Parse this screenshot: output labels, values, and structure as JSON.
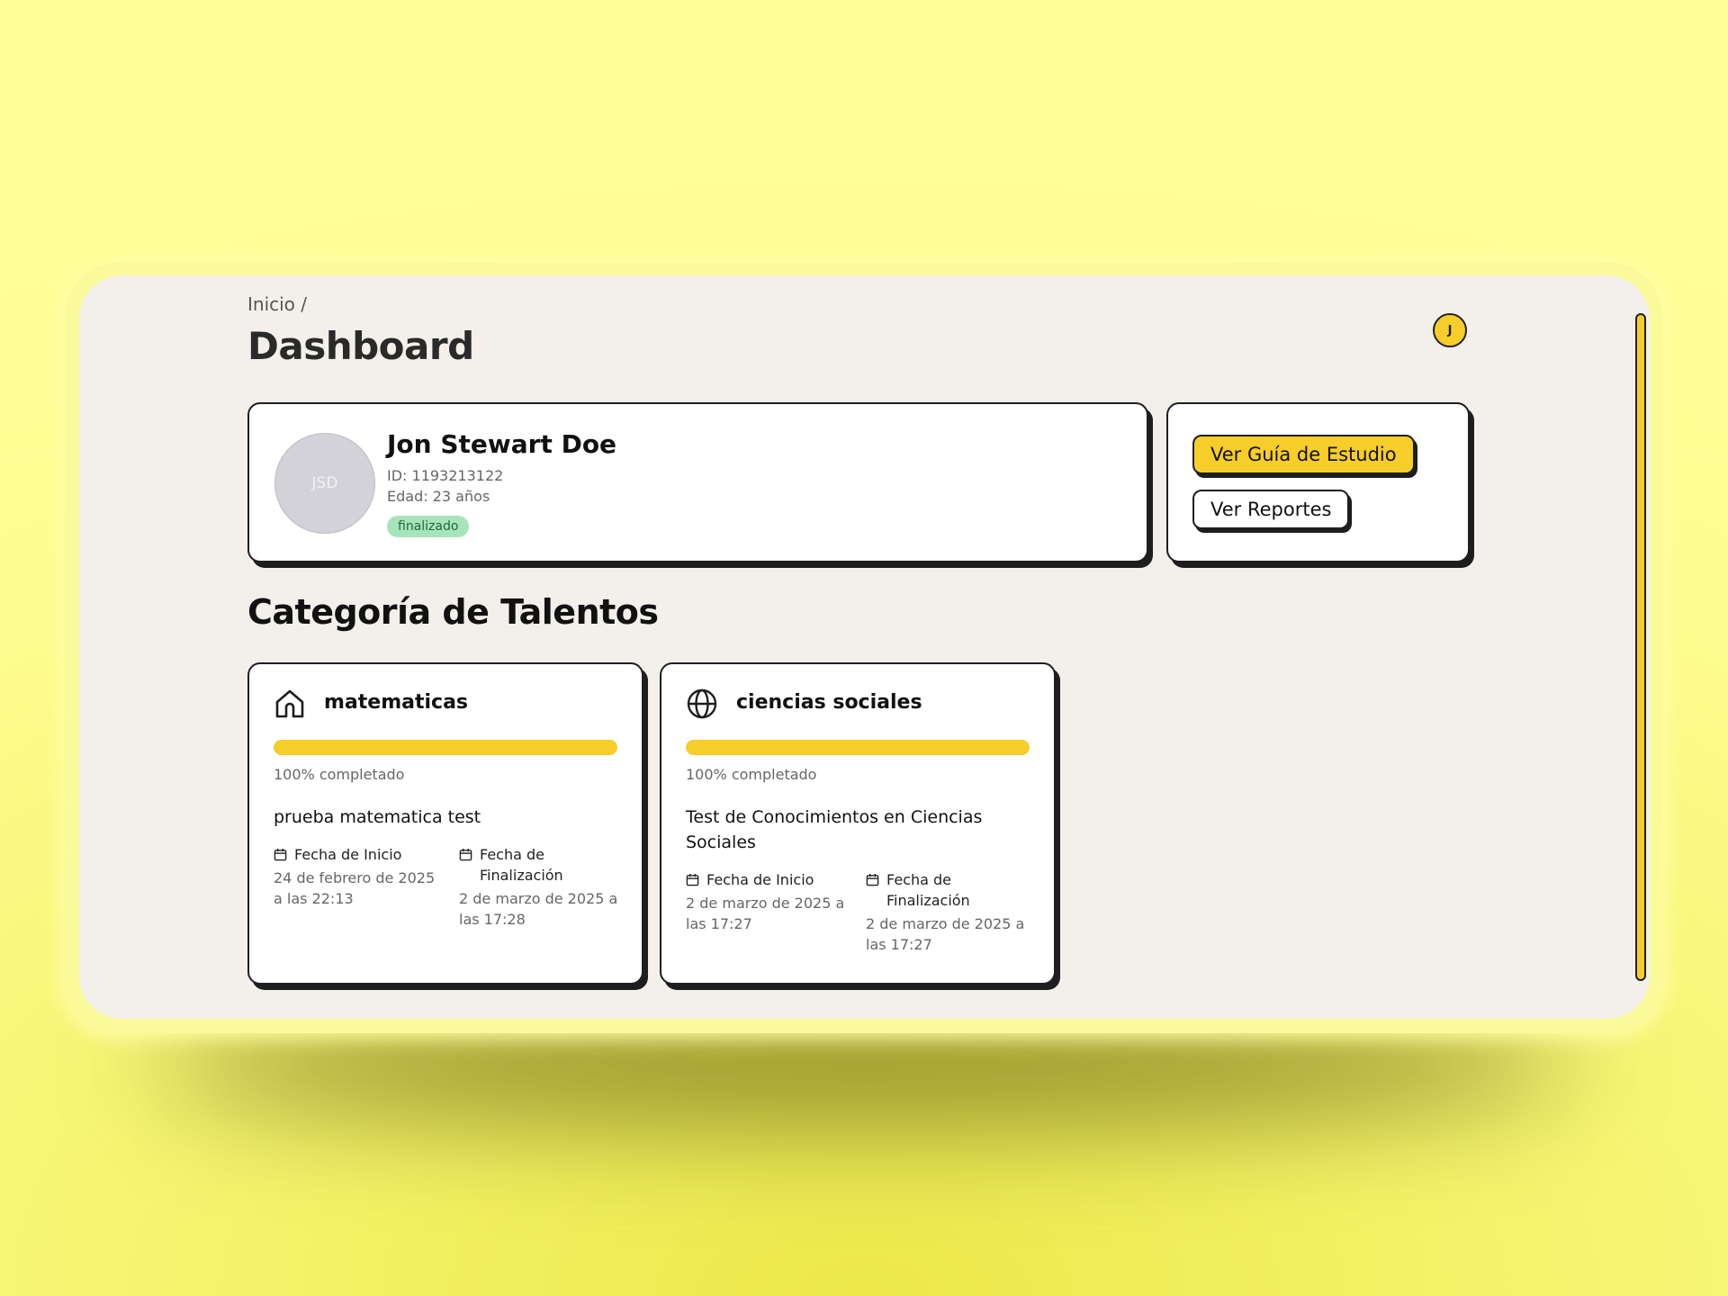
{
  "breadcrumb": {
    "text": "Inicio /"
  },
  "page": {
    "title": "Dashboard"
  },
  "user_menu": {
    "initial": "J"
  },
  "profile": {
    "initials": "JSD",
    "name": "Jon Stewart Doe",
    "id_text": "ID: 1193213122",
    "age_text": "Edad: 23 años",
    "status": "finalizado",
    "status_color": "#a8e4bb"
  },
  "actions": {
    "study_guide_label": "Ver Guía de Estudio",
    "reports_label": "Ver Reportes"
  },
  "talents": {
    "section_title": "Categoría de Talentos",
    "items": [
      {
        "icon": "home-icon",
        "name": "matematicas",
        "progress_percent": 100,
        "progress_text": "100% completado",
        "test_name": "prueba matematica test",
        "start_label": "Fecha de Inicio",
        "start_value": "24 de febrero de 2025 a las 22:13",
        "end_label": "Fecha de Finalización",
        "end_value": "2 de marzo de 2025 a las 17:28"
      },
      {
        "icon": "globe-icon",
        "name": "ciencias sociales",
        "progress_percent": 100,
        "progress_text": "100% completado",
        "test_name": "Test de Conocimientos en Ciencias Sociales",
        "start_label": "Fecha de Inicio",
        "start_value": "2 de marzo de 2025 a las 17:27",
        "end_label": "Fecha de Finalización",
        "end_value": "2 de marzo de 2025 a las 17:27"
      }
    ]
  },
  "colors": {
    "accent": "#f7cd29",
    "background": "#ffff98",
    "panel": "#f3f0ec",
    "border": "#1e1e1e"
  }
}
